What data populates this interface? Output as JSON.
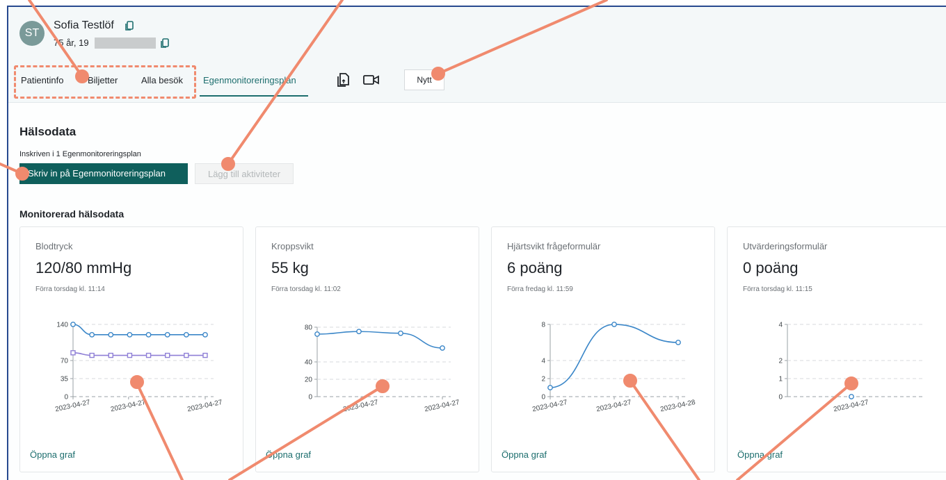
{
  "patient": {
    "initials": "ST",
    "name": "Sofia Testlöf",
    "age": "75 år, 19"
  },
  "tabs": [
    {
      "label": "Patientinfo"
    },
    {
      "label": "Biljetter"
    },
    {
      "label": "Alla besök"
    },
    {
      "label": "Egenmonitoreringsplan",
      "active": true
    }
  ],
  "toolbar": {
    "nytt_label": "Nytt",
    "icons": [
      "document-icon",
      "video-icon"
    ]
  },
  "main": {
    "title": "Hälsodata",
    "enrolled_text": "Inskriven i 1 Egenmonitoreringsplan",
    "enroll_button": "Skriv in på Egenmonitoreringsplan",
    "add_activity_button": "Lägg till aktiviteter",
    "monitored_title": "Monitorerad hälsodata"
  },
  "cards": [
    {
      "label": "Blodtryck",
      "value": "120/80 mmHg",
      "time": "Förra torsdag kl. 11:14",
      "link": "Öppna graf"
    },
    {
      "label": "Kroppsvikt",
      "value": "55 kg",
      "time": "Förra torsdag kl. 11:02",
      "link": "Öppna graf"
    },
    {
      "label": "Hjärtsvikt frågeformulär",
      "value": "6 poäng",
      "time": "Förra fredag kl. 11:59",
      "link": "Öppna graf"
    },
    {
      "label": "Utvärderingsformulär",
      "value": "0 poäng",
      "time": "Förra torsdag kl. 11:15",
      "link": "Öppna graf"
    }
  ],
  "colors": {
    "accent": "#0f5f5c",
    "link": "#1d6e6e",
    "series_primary": "#3a86c8",
    "series_secondary": "#8f7fd6",
    "callout": "#f08a6e",
    "frame": "#27498f"
  },
  "chart_data": [
    {
      "type": "line",
      "yticks": [
        "0",
        "35",
        "70",
        "140"
      ],
      "xticks": [
        "2023-04-27",
        "2023-04-27",
        "2023-04-27"
      ],
      "series": [
        {
          "values": [
            140,
            120,
            120,
            120,
            120,
            120,
            120,
            120
          ]
        },
        {
          "values": [
            85,
            80,
            80,
            80,
            80,
            80,
            80,
            80
          ]
        }
      ]
    },
    {
      "type": "line",
      "yticks": [
        "0",
        "20",
        "40",
        "80"
      ],
      "xticks": [
        "2023-04-27",
        "2023-04-27"
      ],
      "series": [
        {
          "values": [
            72,
            75,
            73,
            56
          ]
        }
      ]
    },
    {
      "type": "line",
      "yticks": [
        "0",
        "2",
        "4",
        "8"
      ],
      "xticks": [
        "2023-04-27",
        "2023-04-27",
        "2023-04-28"
      ],
      "series": [
        {
          "values": [
            1,
            8,
            6
          ]
        }
      ]
    },
    {
      "type": "line",
      "yticks": [
        "0",
        "1",
        "2",
        "4"
      ],
      "xticks": [
        "2023-04-27"
      ],
      "series": [
        {
          "values": [
            0
          ]
        }
      ]
    }
  ]
}
